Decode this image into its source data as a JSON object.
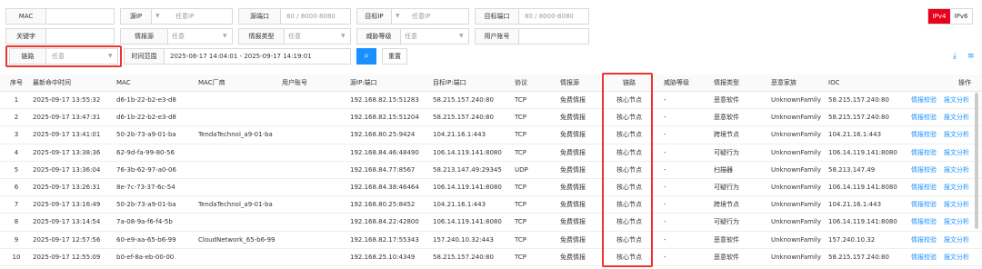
{
  "filters": {
    "mac": {
      "label": "MAC",
      "value": ""
    },
    "src_ip": {
      "label": "源IP",
      "placeholder": "任意IP"
    },
    "src_port": {
      "label": "源端口",
      "placeholder": "80 / 8000-8080"
    },
    "dst_ip": {
      "label": "目标IP",
      "placeholder": "任意IP"
    },
    "dst_port": {
      "label": "目标端口",
      "placeholder": "80 / 8000-8080"
    },
    "keyword": {
      "label": "关键字",
      "value": ""
    },
    "intel_source": {
      "label": "情报源",
      "value": "任意"
    },
    "intel_type": {
      "label": "情报类型",
      "value": "任意"
    },
    "threat_level": {
      "label": "威胁等级",
      "value": "任意"
    },
    "user_account": {
      "label": "用户账号",
      "value": ""
    },
    "link": {
      "label": "链路",
      "value": "任意"
    },
    "time_range": {
      "label": "时间范围",
      "value": "2025-08-17 14:04:01 - 2025-09-17 14:19:01"
    },
    "search_icon": "search-icon",
    "reset_label": "重置"
  },
  "ip_version": {
    "options": [
      "IPv4",
      "IPv6"
    ],
    "selected": "IPv4"
  },
  "toolbar": {
    "icons": [
      "download-icon",
      "column-settings-icon"
    ]
  },
  "table": {
    "headers": [
      "序号",
      "最新命中时间",
      "MAC",
      "MAC厂商",
      "用户账号",
      "源IP:端口",
      "目标IP:端口",
      "协议",
      "情报源",
      "链路",
      "威胁等级",
      "情报类型",
      "恶意家族",
      "IOC",
      "操作"
    ],
    "actions": [
      "情报校验",
      "报文分析"
    ],
    "rows": [
      [
        "1",
        "2025-09-17 13:55:32",
        "d6-1b-22-b2-e3-d8",
        "",
        "",
        "192.168.82.15:51283",
        "58.215.157.240:80",
        "TCP",
        "免费情报",
        "核心节点",
        "-",
        "恶意软件",
        "UnknownFamily",
        "58.215.157.240:80"
      ],
      [
        "2",
        "2025-09-17 13:47:31",
        "d6-1b-22-b2-e3-d8",
        "",
        "",
        "192.168.82.15:51204",
        "58.215.157.240:80",
        "TCP",
        "免费情报",
        "核心节点",
        "-",
        "恶意软件",
        "UnknownFamily",
        "58.215.157.240:80"
      ],
      [
        "3",
        "2025-09-17 13:41:01",
        "50-2b-73-a9-01-ba",
        "TendaTechnol_a9-01-ba",
        "",
        "192.168.80.25:9424",
        "104.21.16.1:443",
        "TCP",
        "免费情报",
        "核心节点",
        "-",
        "跨境节点",
        "UnknownFamily",
        "104.21.16.1:443"
      ],
      [
        "4",
        "2025-09-17 13:38:36",
        "62-9d-fa-99-80-56",
        "",
        "",
        "192.168.84.46:48490",
        "106.14.119.141:8080",
        "TCP",
        "免费情报",
        "核心节点",
        "-",
        "可疑行为",
        "UnknownFamily",
        "106.14.119.141:8080"
      ],
      [
        "5",
        "2025-09-17 13:36:04",
        "76-3b-62-97-a0-06",
        "",
        "",
        "192.168.84.77:8567",
        "58.213.147.49:29345",
        "UDP",
        "免费情报",
        "核心节点",
        "-",
        "扫描器",
        "UnknownFamily",
        "58.213.147.49"
      ],
      [
        "6",
        "2025-09-17 13:26:31",
        "8e-7c-73-37-6c-54",
        "",
        "",
        "192.168.84.38:46464",
        "106.14.119.141:8080",
        "TCP",
        "免费情报",
        "核心节点",
        "-",
        "可疑行为",
        "UnknownFamily",
        "106.14.119.141:8080"
      ],
      [
        "7",
        "2025-09-17 13:16:49",
        "50-2b-73-a9-01-ba",
        "TendaTechnol_a9-01-ba",
        "",
        "192.168.80.25:8452",
        "104.21.16.1:443",
        "TCP",
        "免费情报",
        "核心节点",
        "-",
        "跨境节点",
        "UnknownFamily",
        "104.21.16.1:443"
      ],
      [
        "8",
        "2025-09-17 13:14:54",
        "7a-08-9a-f6-f4-5b",
        "",
        "",
        "192.168.84.22:42800",
        "106.14.119.141:8080",
        "TCP",
        "免费情报",
        "核心节点",
        "-",
        "可疑行为",
        "UnknownFamily",
        "106.14.119.141:8080"
      ],
      [
        "9",
        "2025-09-17 12:57:56",
        "60-e9-aa-65-b6-99",
        "CloudNetwork_65-b6-99",
        "",
        "192.168.82.17:55343",
        "157.240.10.32:443",
        "TCP",
        "免费情报",
        "核心节点",
        "-",
        "恶意软件",
        "UnknownFamily",
        "157.240.10.32"
      ],
      [
        "10",
        "2025-09-17 12:55:09",
        "b0-ef-8a-eb-00-00",
        "",
        "",
        "192.168.25.10:4349",
        "58.215.157.240:80",
        "TCP",
        "免费情报",
        "核心节点",
        "-",
        "恶意软件",
        "UnknownFamily",
        "58.215.157.240:80"
      ]
    ]
  },
  "colors": {
    "accent": "#1890ff",
    "ipv4_active": "#e8001c",
    "highlight": "#ee3333"
  }
}
